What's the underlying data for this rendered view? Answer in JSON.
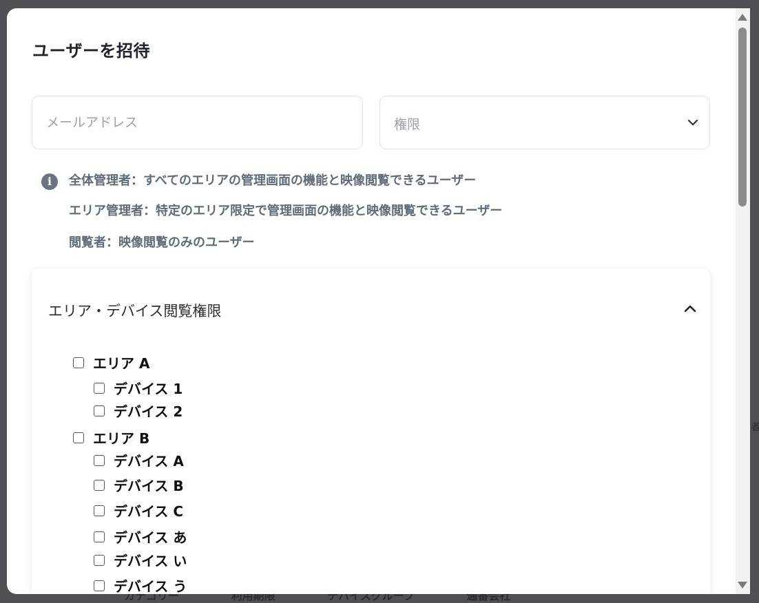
{
  "backdrop": {
    "columns": [
      "カテゴリー",
      "利用期限",
      "デバイスグループ",
      "通番会社"
    ],
    "side_char": "者"
  },
  "modal": {
    "title": "ユーザーを招待",
    "email_placeholder": "メールアドレス",
    "role_placeholder": "権限",
    "info_lines": [
      "全体管理者：すべてのエリアの管理画面の機能と映像閲覧できるユーザー",
      "エリア管理者：特定のエリア限定で管理画面の機能と映像閲覧できるユーザー",
      "閲覧者：映像閲覧のみのユーザー"
    ]
  },
  "permissions": {
    "title": "エリア・デバイス閲覧権限",
    "areas": [
      {
        "label": "エリア A",
        "devices": [
          "デバイス 1",
          "デバイス 2"
        ]
      },
      {
        "label": "エリア B",
        "devices": [
          "デバイス A",
          "デバイス B",
          "デバイス C",
          "デバイス あ",
          "デバイス い",
          "デバイス う"
        ]
      }
    ]
  }
}
